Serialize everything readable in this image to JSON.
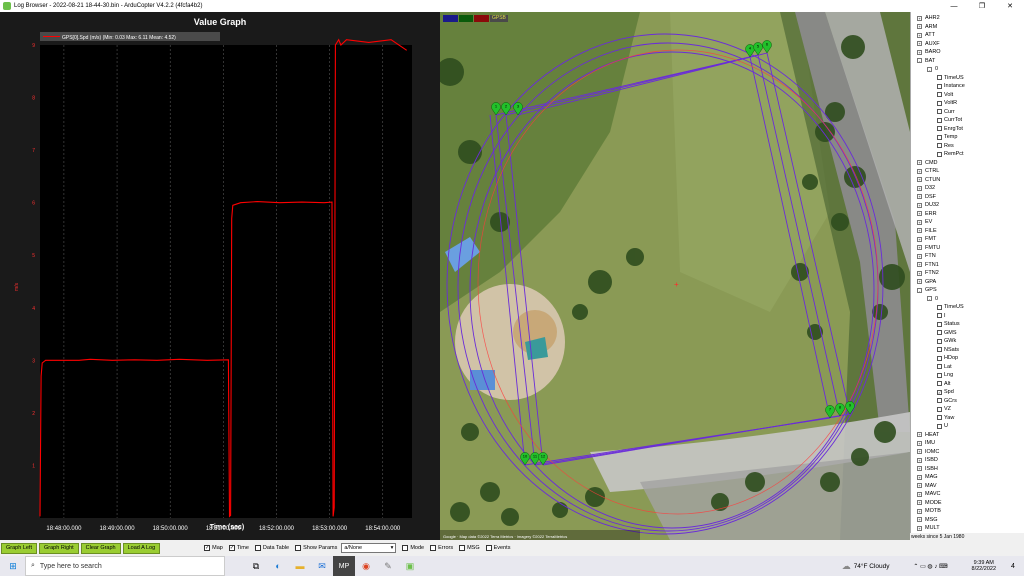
{
  "window": {
    "title": "Log Browser - 2022-08-21 18-44-30.bin - ArduCopter V4.2.2 (4fcfa4b2)",
    "minimize": "—",
    "maximize": "❐",
    "close": "✕"
  },
  "graph": {
    "title": "Value Graph",
    "legend": "GPS[0].Spd (m/s)  (Min: 0.03 Max: 6.11 Mean: 4.52)",
    "xlabel": "Time (sec)",
    "ylabel": "m/s",
    "bg_color": "#1a1a1a",
    "line_color": "#ff0000"
  },
  "chart_data": {
    "type": "line",
    "title": "Value Graph",
    "xlabel": "Time (sec)",
    "ylabel": "m/s",
    "xlim": [
      0,
      1
    ],
    "ylim": [
      0,
      9
    ],
    "x_ticks": [
      "18:48:00.000",
      "18:49:00.000",
      "18:50:00.000",
      "18:51:00.000",
      "18:52:00.000",
      "18:53:00.000",
      "18:54:00.000"
    ],
    "y_ticks": [
      "1",
      "2",
      "3",
      "4",
      "5",
      "6",
      "7",
      "8",
      "9"
    ],
    "grid": true,
    "series": [
      {
        "name": "GPS[0].Spd (m/s)",
        "color": "#ff0000",
        "x": [
          18.45,
          18.46,
          18.47,
          18.5,
          18.8,
          18.9,
          19.1,
          19.3,
          19.5,
          19.7,
          19.95,
          20.14,
          20.15,
          20.16,
          20.17,
          20.18,
          20.25,
          20.4,
          20.6,
          20.8,
          21.0,
          21.07,
          21.08,
          21.09,
          21.1,
          21.13,
          21.14,
          21.15,
          21.2,
          21.4,
          21.6,
          21.74
        ],
        "y": [
          0.03,
          2.7,
          2.95,
          3.0,
          3.0,
          3.02,
          3.0,
          3.01,
          3.0,
          3.02,
          3.0,
          3.01,
          0.03,
          0.05,
          5.7,
          5.95,
          6.0,
          6.02,
          6.0,
          6.01,
          6.0,
          6.01,
          0.03,
          0.2,
          9.0,
          9.1,
          9.05,
          9.0,
          9.1,
          9.05,
          9.1,
          8.9
        ]
      }
    ]
  },
  "map": {
    "legend": [
      "DEG",
      "GPS",
      "POS",
      "GPSB"
    ],
    "attribution": "Google · Map data ©2022 Terra Metrics · Imagery ©2022 TerraMetrics",
    "waypoints": [
      "1",
      "2",
      "3",
      "4",
      "5",
      "6",
      "7",
      "8",
      "9",
      "10",
      "11",
      "12"
    ]
  },
  "tree": {
    "items": [
      {
        "label": "AHR2",
        "exp": "+"
      },
      {
        "label": "ARM",
        "exp": "+"
      },
      {
        "label": "ATT",
        "exp": "+"
      },
      {
        "label": "AUXF",
        "exp": "+"
      },
      {
        "label": "BARO",
        "exp": "+"
      },
      {
        "label": "BAT",
        "exp": "-"
      },
      {
        "label": "0",
        "exp": "-",
        "indent": 1
      },
      {
        "label": "TimeUS",
        "chk": "",
        "indent": 2
      },
      {
        "label": "Instance",
        "chk": "",
        "indent": 2
      },
      {
        "label": "Volt",
        "chk": "",
        "indent": 2
      },
      {
        "label": "VoltR",
        "chk": "",
        "indent": 2
      },
      {
        "label": "Curr",
        "chk": "",
        "indent": 2
      },
      {
        "label": "CurrTot",
        "chk": "",
        "indent": 2
      },
      {
        "label": "EnrgTot",
        "chk": "",
        "indent": 2
      },
      {
        "label": "Temp",
        "chk": "",
        "indent": 2
      },
      {
        "label": "Res",
        "chk": "",
        "indent": 2
      },
      {
        "label": "RemPct",
        "chk": "",
        "indent": 2
      },
      {
        "label": "CMD",
        "exp": "+"
      },
      {
        "label": "CTRL",
        "exp": "+"
      },
      {
        "label": "CTUN",
        "exp": "+"
      },
      {
        "label": "D32",
        "exp": "+"
      },
      {
        "label": "DSF",
        "exp": "+"
      },
      {
        "label": "DU32",
        "exp": "+"
      },
      {
        "label": "ERR",
        "exp": "+"
      },
      {
        "label": "EV",
        "exp": "+"
      },
      {
        "label": "FILE",
        "exp": "+"
      },
      {
        "label": "FMT",
        "exp": "+"
      },
      {
        "label": "FMTU",
        "exp": "+"
      },
      {
        "label": "FTN",
        "exp": "+"
      },
      {
        "label": "FTN1",
        "exp": "+"
      },
      {
        "label": "FTN2",
        "exp": "+"
      },
      {
        "label": "GPA",
        "exp": "+"
      },
      {
        "label": "GPS",
        "exp": "-"
      },
      {
        "label": "0",
        "exp": "-",
        "indent": 1
      },
      {
        "label": "TimeUS",
        "chk": "",
        "indent": 2
      },
      {
        "label": "I",
        "chk": "",
        "indent": 2
      },
      {
        "label": "Status",
        "chk": "",
        "indent": 2
      },
      {
        "label": "GMS",
        "chk": "",
        "indent": 2
      },
      {
        "label": "GWk",
        "chk": "",
        "indent": 2
      },
      {
        "label": "NSats",
        "chk": "",
        "indent": 2
      },
      {
        "label": "HDop",
        "chk": "",
        "indent": 2
      },
      {
        "label": "Lat",
        "chk": "",
        "indent": 2
      },
      {
        "label": "Lng",
        "chk": "",
        "indent": 2
      },
      {
        "label": "Alt",
        "chk": "",
        "indent": 2
      },
      {
        "label": "Spd",
        "chk": "✓",
        "indent": 2
      },
      {
        "label": "GCrs",
        "chk": "",
        "indent": 2
      },
      {
        "label": "VZ",
        "chk": "",
        "indent": 2
      },
      {
        "label": "Yaw",
        "chk": "",
        "indent": 2
      },
      {
        "label": "U",
        "chk": "",
        "indent": 2
      },
      {
        "label": "HEAT",
        "exp": "+"
      },
      {
        "label": "IMU",
        "exp": "+"
      },
      {
        "label": "IOMC",
        "exp": "+"
      },
      {
        "label": "ISBD",
        "exp": "+"
      },
      {
        "label": "ISBH",
        "exp": "+"
      },
      {
        "label": "MAG",
        "exp": "+"
      },
      {
        "label": "MAV",
        "exp": "+"
      },
      {
        "label": "MAVC",
        "exp": "+"
      },
      {
        "label": "MODE",
        "exp": "+"
      },
      {
        "label": "MOTB",
        "exp": "+"
      },
      {
        "label": "MSG",
        "exp": "+"
      },
      {
        "label": "MULT",
        "exp": "+"
      }
    ],
    "status": "weeks since 5 Jan 1980"
  },
  "toolbar": {
    "graph_left": "Graph Left",
    "graph_right": "Graph Right",
    "clear_graph": "Clear Graph",
    "load_log": "Load A Log",
    "map": {
      "label": "Map",
      "checked": "✓"
    },
    "time": {
      "label": "Time",
      "checked": "✓"
    },
    "data_table": {
      "label": "Data Table",
      "checked": ""
    },
    "show_params": {
      "label": "Show Params",
      "checked": ""
    },
    "select_value": "a/None",
    "mode": {
      "label": "Mode",
      "checked": ""
    },
    "errors": {
      "label": "Errors",
      "checked": ""
    },
    "msg": {
      "label": "MSG",
      "checked": ""
    },
    "events": {
      "label": "Events",
      "checked": ""
    }
  },
  "taskbar": {
    "search_placeholder": "Type here to search",
    "weather": "74°F  Cloudy",
    "time": "9:39 AM",
    "date": "8/22/2022",
    "notif": "4"
  }
}
